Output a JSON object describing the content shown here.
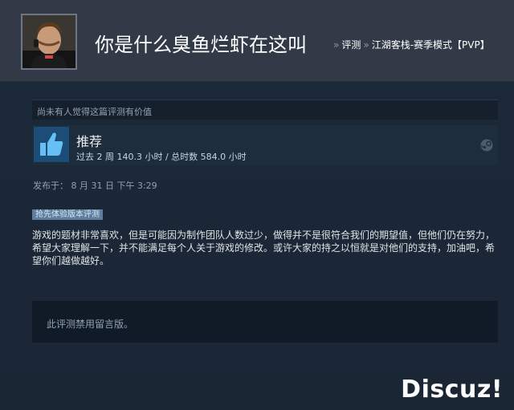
{
  "header": {
    "review_title": "你是什么臭鱼烂虾在这叫",
    "breadcrumb_sep": "»",
    "breadcrumb_reviews": "评测",
    "breadcrumb_game": "江湖客栈-赛季模式【PVP】"
  },
  "review": {
    "helpful_text": "尚未有人觉得这篇评测有价值",
    "recommendation": "推荐",
    "hours": "过去 2 周 140.3 小时 / 总时数 584.0 小时",
    "posted": "发布于：  8 月 31 日 下午 3:29",
    "early_access_badge": "抢先体验版本评测",
    "body": "游戏的题材非常喜欢，但是可能因为制作团队人数过少，做得并不是很符合我们的期望值，但他们仍在努力，希望大家理解一下，并不能满足每个人关于游戏的修改。或许大家的持之以恒就是对他们的支持，加油吧，希望你们越做越好。",
    "comments_disabled": "此评测禁用留言版。"
  },
  "watermark": "Discuz!",
  "icons": {
    "avatar": "avatar",
    "thumb": "thumbs-up-icon",
    "steam": "steam-logo-icon"
  },
  "colors": {
    "header_bg": "#313a46",
    "page_bg": "#1b2838",
    "thumb_bg": "#1b4d76",
    "thumb_fg": "#66c0f4",
    "badge_bg": "#5d7e9f"
  }
}
